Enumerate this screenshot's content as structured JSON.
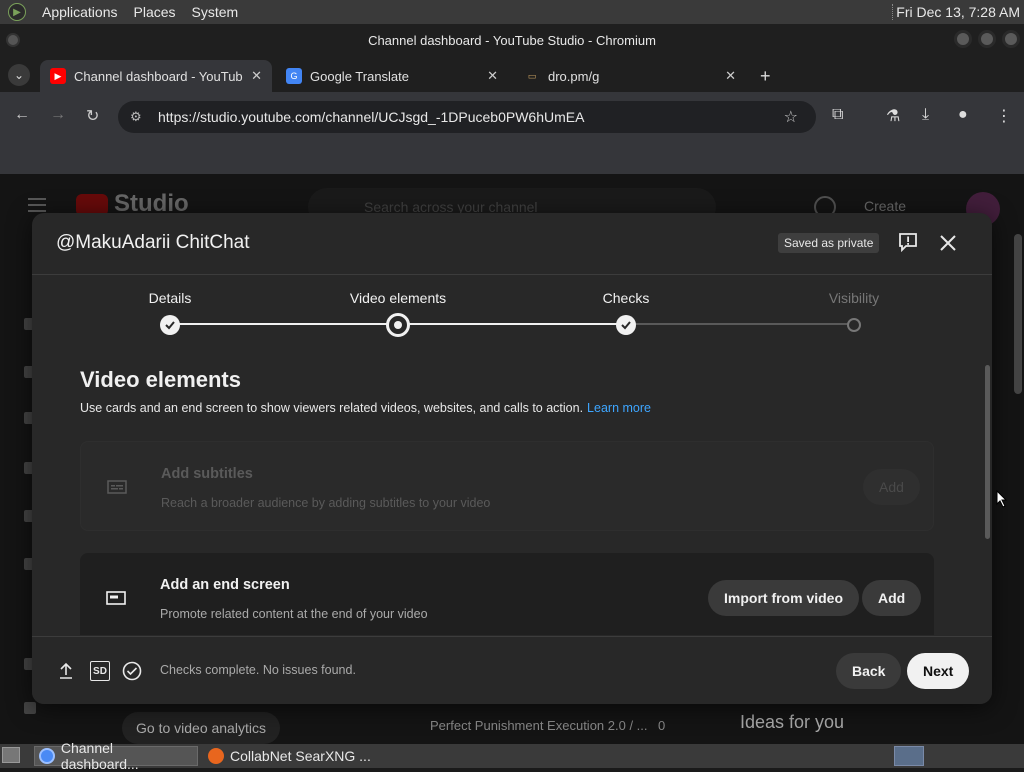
{
  "os_topbar": {
    "menus": [
      "Applications",
      "Places",
      "System"
    ],
    "clock": "Fri Dec 13,  7:28 AM"
  },
  "window": {
    "title": "Channel dashboard - YouTube Studio - Chromium"
  },
  "tabs": [
    {
      "title": "Channel dashboard - YouTub",
      "favicon": "youtube-studio-icon",
      "active": true
    },
    {
      "title": "Google Translate",
      "favicon": "google-translate-icon",
      "active": false
    },
    {
      "title": "dro.pm/g",
      "favicon": "folder-icon",
      "active": false
    }
  ],
  "toolbar": {
    "url": "https://studio.youtube.com/channel/UCJsgd_-1DPuceb0PW6hUmEA"
  },
  "background_page": {
    "logo_text": "Studio",
    "search_placeholder": "Search across your channel",
    "create_label": "Create",
    "analytics_button": "Go to video analytics",
    "video_title": "Perfect Punishment Execution 2.0 / ...",
    "video_count": "0",
    "ideas_heading": "Ideas for you"
  },
  "dialog": {
    "title": "@MakuAdarii ChitChat",
    "saved_badge": "Saved as private",
    "steps": [
      {
        "label": "Details",
        "state": "done"
      },
      {
        "label": "Video elements",
        "state": "current"
      },
      {
        "label": "Checks",
        "state": "done"
      },
      {
        "label": "Visibility",
        "state": "pending"
      }
    ],
    "section_title": "Video elements",
    "section_desc": "Use cards and an end screen to show viewers related videos, websites, and calls to action.",
    "learn_more": "Learn more",
    "cards": [
      {
        "title": "Add subtitles",
        "desc": "Reach a broader audience by adding subtitles to your video",
        "button": "Add",
        "enabled": false
      },
      {
        "title": "Add an end screen",
        "desc": "Promote related content at the end of your video",
        "import_button": "Import from video",
        "button": "Add",
        "enabled": true
      }
    ],
    "footer": {
      "status": "Checks complete. No issues found.",
      "quality": "SD",
      "back": "Back",
      "next": "Next"
    }
  },
  "taskbar": {
    "items": [
      "Channel dashboard...",
      "CollabNet SearXNG ..."
    ]
  },
  "colors": {
    "dialog_bg": "#282828",
    "accent_link": "#3ea6ff",
    "youtube_red": "#cc0000"
  }
}
